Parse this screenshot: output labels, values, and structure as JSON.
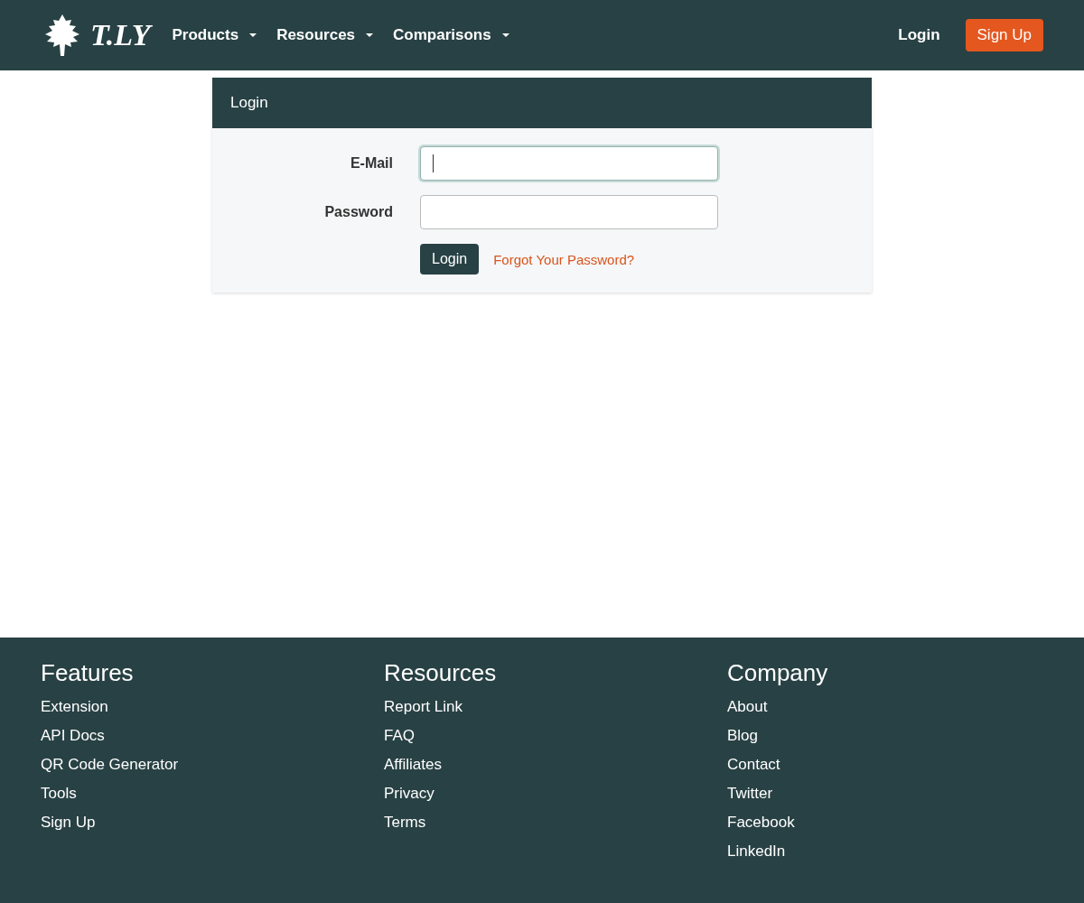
{
  "navbar": {
    "logo": "T.LY",
    "menus": [
      {
        "label": "Products"
      },
      {
        "label": "Resources"
      },
      {
        "label": "Comparisons"
      }
    ],
    "login": "Login",
    "signup": "Sign Up"
  },
  "login_card": {
    "title": "Login",
    "fields": [
      {
        "label": "E-Mail",
        "focused": true
      },
      {
        "label": "Password",
        "focused": false
      }
    ],
    "submit": "Login",
    "forgot": "Forgot Your Password?"
  },
  "footer": {
    "columns": [
      {
        "heading": "Features",
        "links": [
          "Extension",
          "API Docs",
          "QR Code Generator",
          "Tools",
          "Sign Up"
        ]
      },
      {
        "heading": "Resources",
        "links": [
          "Report Link",
          "FAQ",
          "Affiliates",
          "Privacy",
          "Terms"
        ]
      },
      {
        "heading": "Company",
        "links": [
          "About",
          "Blog",
          "Contact",
          "Twitter",
          "Facebook",
          "LinkedIn"
        ]
      }
    ]
  }
}
